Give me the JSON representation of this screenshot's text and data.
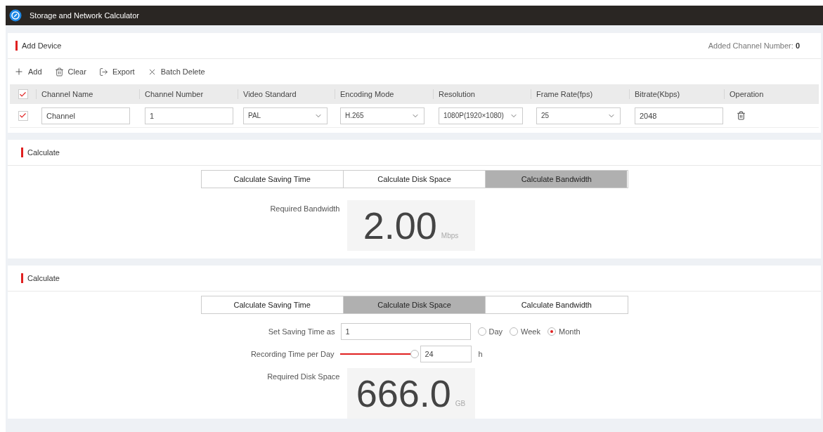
{
  "title_bar": {
    "title": "Storage and Network Calculator"
  },
  "add_device": {
    "title": "Add Device",
    "count_label": "Added Channel Number:",
    "count": "0",
    "toolbar": [
      {
        "kind": "add",
        "label": "Add"
      },
      {
        "kind": "clear",
        "label": "Clear"
      },
      {
        "kind": "export",
        "label": "Export"
      },
      {
        "kind": "batch_delete",
        "label": "Batch Delete"
      }
    ],
    "header_checked": true,
    "columns": [
      "Channel Name",
      "Channel Number",
      "Video Standard",
      "Encoding Mode",
      "Resolution",
      "Frame Rate(fps)",
      "Bitrate(Kbps)",
      "Operation"
    ],
    "rows": [
      {
        "checked": true,
        "cells": [
          {
            "kind": "input",
            "value": "Channel"
          },
          {
            "kind": "input",
            "value": "1"
          },
          {
            "kind": "select",
            "value": "PAL"
          },
          {
            "kind": "select",
            "value": "H.265"
          },
          {
            "kind": "select",
            "value": "1080P(1920×1080)"
          },
          {
            "kind": "select",
            "value": "25"
          },
          {
            "kind": "input",
            "value": "2048"
          },
          {
            "kind": "delete"
          }
        ]
      }
    ]
  },
  "calculators": [
    {
      "title": "Calculate",
      "tabs": [
        {
          "label": "Calculate Saving Time",
          "selected": false
        },
        {
          "label": "Calculate Disk Space",
          "selected": false
        },
        {
          "label": "Calculate Bandwidth",
          "selected": true
        }
      ],
      "result": {
        "label": "Required Bandwidth",
        "value": "2.00",
        "unit": "Mbps"
      }
    },
    {
      "title": "Calculate",
      "tabs": [
        {
          "label": "Calculate Saving Time",
          "selected": false
        },
        {
          "label": "Calculate Disk Space",
          "selected": true
        },
        {
          "label": "Calculate Bandwidth",
          "selected": false
        }
      ],
      "saving_time": {
        "label": "Set Saving Time as",
        "value": "1",
        "options": [
          {
            "label": "Day",
            "selected": false
          },
          {
            "label": "Week",
            "selected": false
          },
          {
            "label": "Month",
            "selected": true
          }
        ]
      },
      "recording": {
        "label": "Recording Time per Day",
        "level": 1,
        "value": "24",
        "unit": "h"
      },
      "result": {
        "label": "Required Disk Space",
        "value": "666.0",
        "unit": "GB"
      }
    }
  ]
}
